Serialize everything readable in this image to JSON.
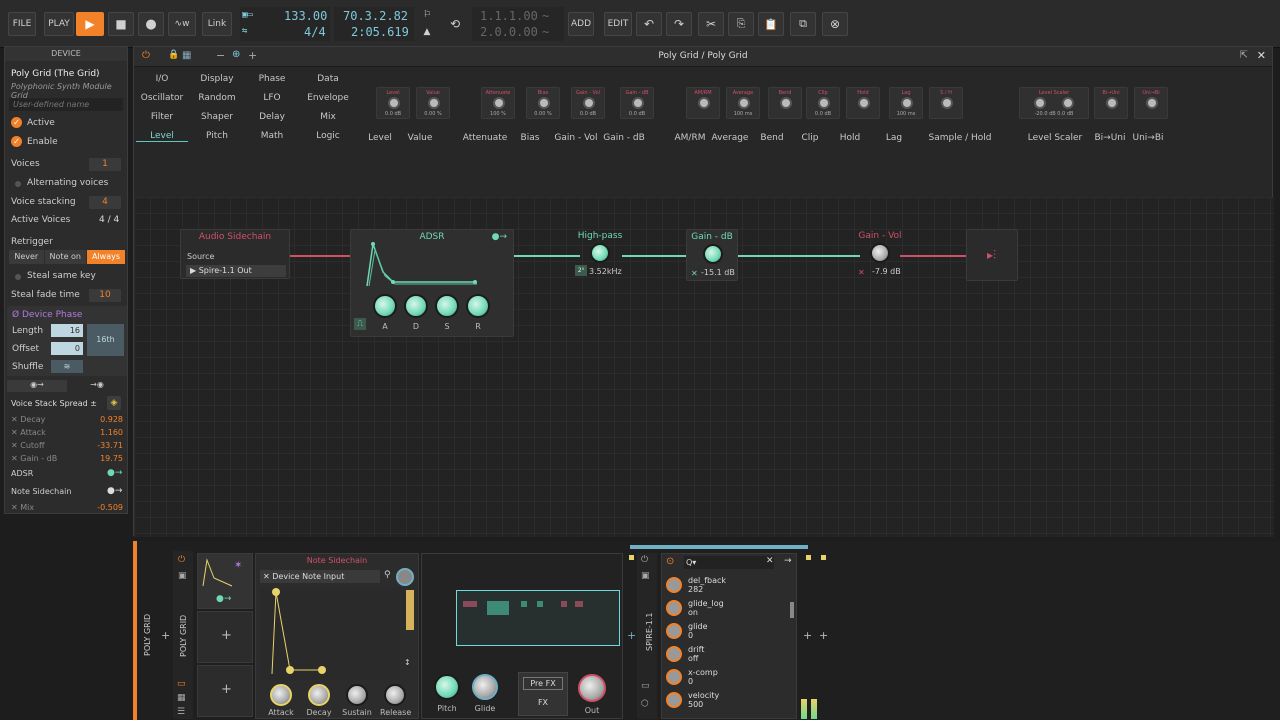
{
  "topbar": {
    "file": "FILE",
    "play": "PLAY",
    "link": "Link",
    "tempo": "133.00",
    "timesig": "4/4",
    "position": "70.3.2.82",
    "time": "2:05.619",
    "loop_start": "1.1.1.00",
    "loop_len": "2.0.0.00",
    "add": "ADD",
    "edit": "EDIT"
  },
  "device": {
    "header": "DEVICE",
    "name": "Poly Grid (The Grid)",
    "subtitle": "Polyphonic Synth Module Grid",
    "user_name_placeholder": "User-defined name",
    "active": "Active",
    "enable": "Enable",
    "voices_label": "Voices",
    "voices": "1",
    "alternating": "Alternating voices",
    "stacking_label": "Voice stacking",
    "stacking": "4",
    "active_voices_label": "Active Voices",
    "active_voices": "4 / 4",
    "retrigger": "Retrigger",
    "retrig_opts": [
      "Never",
      "Note on",
      "Always"
    ],
    "steal_same": "Steal same key",
    "steal_fade_label": "Steal fade time",
    "steal_fade": "10",
    "phase_title": "Ø Device Phase",
    "length_label": "Length",
    "length": "16",
    "length_unit": "16th",
    "offset_label": "Offset",
    "offset": "0",
    "shuffle_label": "Shuffle",
    "tab_icons": [
      "◉→",
      "→◉"
    ],
    "spread_title": "Voice Stack Spread ±",
    "mods": [
      {
        "name": "Decay",
        "value": "0.928"
      },
      {
        "name": "Attack",
        "value": "1.160"
      },
      {
        "name": "Cutoff",
        "value": "-33.71"
      },
      {
        "name": "Gain - dB",
        "value": "19.75"
      }
    ],
    "adsr_label": "ADSR",
    "sidechain_label": "Note Sidechain",
    "mix_label": "Mix",
    "mix_value": "-0.509"
  },
  "grid": {
    "title": "Poly Grid / Poly Grid",
    "categories": [
      [
        "I/O",
        "Display",
        "Phase",
        "Data"
      ],
      [
        "Oscillator",
        "Random",
        "LFO",
        "Envelope"
      ],
      [
        "Filter",
        "Shaper",
        "Delay",
        "Mix"
      ],
      [
        "Level",
        "Pitch",
        "Math",
        "Logic"
      ]
    ],
    "palette": [
      {
        "label": "Level",
        "tiny": "Level",
        "val": "0.0 dB"
      },
      {
        "label": "Value",
        "tiny": "Value",
        "val": "0.00 %"
      },
      {
        "label": "Attenuate",
        "tiny": "Attenuate",
        "val": "100 %"
      },
      {
        "label": "Bias",
        "tiny": "Bias",
        "val": "0.00 %"
      },
      {
        "label": "Gain - Vol",
        "tiny": "Gain - Vol",
        "val": "0.0 dB"
      },
      {
        "label": "Gain - dB",
        "tiny": "Gain - dB",
        "val": "0.0 dB"
      },
      {
        "label": "AM/RM",
        "tiny": "AM/RM",
        "val": ""
      },
      {
        "label": "Average",
        "tiny": "Average",
        "val": "100 ms"
      },
      {
        "label": "Bend",
        "tiny": "Bend",
        "val": ""
      },
      {
        "label": "Clip",
        "tiny": "Clip",
        "val": "0.0 dB"
      },
      {
        "label": "Hold",
        "tiny": "Hold",
        "val": ""
      },
      {
        "label": "Lag",
        "tiny": "Lag",
        "val": "100 ms"
      },
      {
        "label": "Sample / Hold",
        "tiny": "S / H",
        "val": ""
      },
      {
        "label": "Level Scaler",
        "tiny": "Level Scaler",
        "val": "-20.0 dB   0.0 dB"
      },
      {
        "label": "Bi→Uni",
        "tiny": "Bi→Uni",
        "val": ""
      },
      {
        "label": "Uni→Bi",
        "tiny": "Uni→Bi",
        "val": ""
      }
    ],
    "sidechain_title": "Audio Sidechain",
    "source_label": "Source",
    "source_value": "▶ Spire-1.1 Out",
    "adsr_title": "ADSR",
    "adsr_knobs": [
      "A",
      "D",
      "S",
      "R"
    ],
    "hp_title": "High-pass",
    "hp_value": "3.52kHz",
    "hp_badge": "2⁰",
    "gaindb_title": "Gain - dB",
    "gaindb_value": "-15.1 dB",
    "gainvol_title": "Gain - Vol",
    "gainvol_value": "-7.9 dB"
  },
  "bottom": {
    "polygrid_label": "POLY GRID",
    "polygrid_label2": "POLY GRID",
    "note_sidechain": "Note Sidechain",
    "note_input": "✕ Device Note Input",
    "env_knobs": [
      "Attack",
      "Decay",
      "Sustain",
      "Release"
    ],
    "pitch": "Pitch",
    "glide": "Glide",
    "pre_fx": "Pre FX",
    "fx": "FX",
    "out": "Out",
    "spire_label": "SPIRE-1.1",
    "search_placeholder": "Q▾",
    "params": [
      {
        "name": "del_fback",
        "value": "282"
      },
      {
        "name": "glide_log",
        "value": "on"
      },
      {
        "name": "glide",
        "value": "0"
      },
      {
        "name": "drift",
        "value": "off"
      },
      {
        "name": "x-comp",
        "value": "0"
      },
      {
        "name": "velocity",
        "value": "500"
      }
    ]
  },
  "colors": {
    "accent": "#f2822a",
    "teal": "#5cc9c0",
    "red": "#d0506a"
  }
}
